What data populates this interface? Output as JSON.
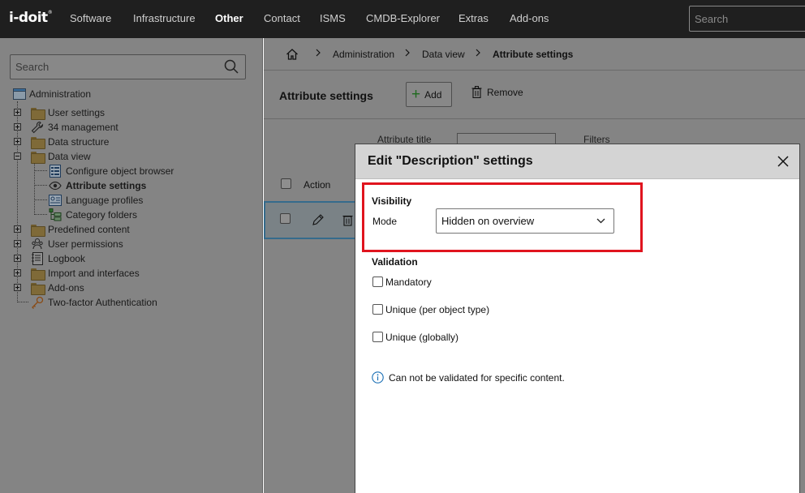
{
  "app": {
    "logo_text": "i-doit",
    "logo_tm": "®"
  },
  "topnav": {
    "items": [
      {
        "label": "Software",
        "active": false
      },
      {
        "label": "Infrastructure",
        "active": false
      },
      {
        "label": "Other",
        "active": true
      },
      {
        "label": "Contact",
        "active": false
      },
      {
        "label": "ISMS",
        "active": false
      },
      {
        "label": "CMDB-Explorer",
        "active": false
      },
      {
        "label": "Extras",
        "active": false
      },
      {
        "label": "Add-ons",
        "active": false
      }
    ],
    "search_placeholder": "Search"
  },
  "sidebar": {
    "search_placeholder": "Search",
    "root_label": "Administration",
    "items": [
      {
        "label": "User settings",
        "icon": "folder-icon",
        "expander": "plus"
      },
      {
        "label": "34 management",
        "icon": "wrench-icon",
        "expander": "plus"
      },
      {
        "label": "Data structure",
        "icon": "folder-icon",
        "expander": "plus"
      },
      {
        "label": "Data view",
        "icon": "folder-icon",
        "expander": "minus"
      },
      {
        "label": "Configure object browser",
        "icon": "object-browser-icon",
        "child": true
      },
      {
        "label": "Attribute settings",
        "icon": "eye-icon",
        "child": true,
        "selected": true
      },
      {
        "label": "Language profiles",
        "icon": "language-profile-icon",
        "child": true
      },
      {
        "label": "Category folders",
        "icon": "category-folders-icon",
        "child": true
      },
      {
        "label": "Predefined content",
        "icon": "folder-icon",
        "expander": "plus"
      },
      {
        "label": "User permissions",
        "icon": "users-icon",
        "expander": "plus"
      },
      {
        "label": "Logbook",
        "icon": "logbook-icon",
        "expander": "plus"
      },
      {
        "label": "Import and interfaces",
        "icon": "folder-icon",
        "expander": "plus"
      },
      {
        "label": "Add-ons",
        "icon": "folder-icon",
        "expander": "plus"
      },
      {
        "label": "Two-factor Authentication",
        "icon": "key-icon",
        "expander": "none"
      }
    ]
  },
  "breadcrumb": {
    "items": [
      "Administration",
      "Data view",
      "Attribute settings"
    ]
  },
  "page": {
    "title": "Attribute settings",
    "add_label": "Add",
    "remove_label": "Remove",
    "filter_label_partial": "Attribute title",
    "filters_label_partial": "Filters",
    "table": {
      "action_header": "Action"
    }
  },
  "modal": {
    "title": "Edit \"Description\" settings",
    "visibility": {
      "section_title": "Visibility",
      "mode_label": "Mode",
      "mode_value": "Hidden on overview"
    },
    "validation": {
      "section_title": "Validation",
      "options": [
        {
          "label": "Mandatory",
          "checked": false
        },
        {
          "label": "Unique (per object type)",
          "checked": false
        },
        {
          "label": "Unique (globally)",
          "checked": false
        }
      ]
    },
    "info_text": "Can not be validated for specific content."
  },
  "colors": {
    "topbar": "#1f1f1f",
    "highlight": "#e0141e",
    "info_blue": "#1a6fb5",
    "add_green": "#1e6a1e"
  }
}
